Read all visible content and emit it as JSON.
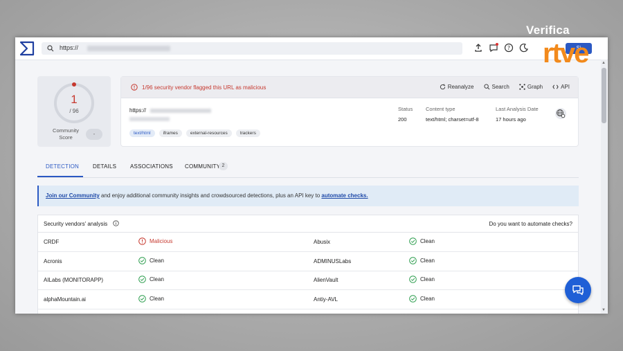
{
  "watermark": {
    "verifica": "Verifica",
    "rtve": "rtve"
  },
  "topbar": {
    "url_prefix": "https://",
    "sign_label": "Si"
  },
  "score": {
    "detections": "1",
    "total": "/ 96",
    "community_label": "Community Score",
    "community_value": "-"
  },
  "summary": {
    "alert_text": "1/96 security vendor flagged this URL as malicious",
    "actions": {
      "reanalyze": "Reanalyze",
      "search": "Search",
      "graph": "Graph",
      "api": "API"
    },
    "url_prefix": "https://",
    "tags": [
      "text/html",
      "iframes",
      "external-resources",
      "trackers"
    ],
    "status_label": "Status",
    "status_value": "200",
    "content_type_label": "Content type",
    "content_type_value": "text/html; charset=utf-8",
    "last_analysis_label": "Last Analysis Date",
    "last_analysis_value": "17 hours ago"
  },
  "tabs": [
    {
      "label": "DETECTION"
    },
    {
      "label": "DETAILS"
    },
    {
      "label": "ASSOCIATIONS"
    },
    {
      "label": "COMMUNITY",
      "count": "2"
    }
  ],
  "banner": {
    "link1": "Join our Community",
    "middle": " and enjoy additional community insights and crowdsourced detections, plus an API key to ",
    "link2": "automate checks."
  },
  "vendors": {
    "title": "Security vendors' analysis",
    "automate_question": "Do you want to automate checks?",
    "rows": [
      {
        "left_name": "CRDF",
        "left_result": "Malicious",
        "right_name": "Abusix",
        "right_result": "Clean"
      },
      {
        "left_name": "Acronis",
        "left_result": "Clean",
        "right_name": "ADMINUSLabs",
        "right_result": "Clean"
      },
      {
        "left_name": "AILabs (MONITORAPP)",
        "left_result": "Clean",
        "right_name": "AlienVault",
        "right_result": "Clean"
      },
      {
        "left_name": "alphaMountain.ai",
        "left_result": "Clean",
        "right_name": "Antiy-AVL",
        "right_result": "Clean"
      }
    ]
  },
  "colors": {
    "accent": "#2b59c3",
    "malicious": "#c6382e",
    "clean": "#2e9e4f",
    "rtve_orange": "#f28a1c"
  }
}
